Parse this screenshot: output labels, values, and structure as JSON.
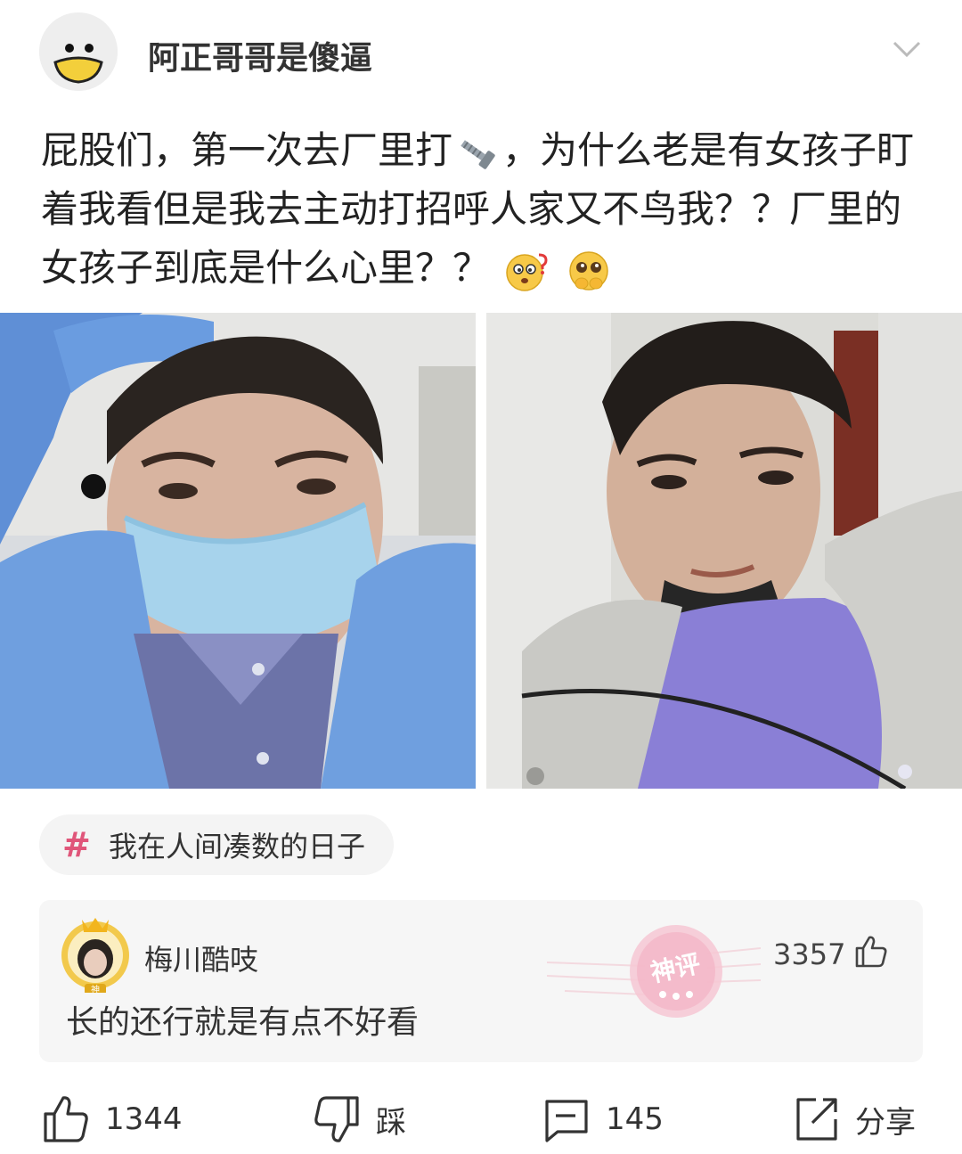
{
  "post": {
    "author": {
      "name": "阿正哥哥是傻逼",
      "avatar_icon": "smiling-face-avatar-icon"
    },
    "menu_icon": "chevron-down-icon",
    "text_part1": "屁股们，第一次去厂里打",
    "text_part2": "，为什么老是有女孩子盯着我看但是我去主动打招呼人家又不鸟我？？厂里的女孩子到底是什么心里？？",
    "inline_icons": [
      "screw-emoji",
      "confused-face-emoji",
      "pleading-face-emoji"
    ],
    "photos": [
      {
        "name": "selfie-cleanroom-suit"
      },
      {
        "name": "selfie-grey-jacket"
      }
    ],
    "topic": {
      "icon": "hash-icon",
      "label": "我在人间凑数的日子"
    }
  },
  "top_comment": {
    "author": "梅川酷吱",
    "badge": "神",
    "text": "长的还行就是有点不好看",
    "stamp_label": "神评",
    "likes": "3357"
  },
  "actions": {
    "like_count": "1344",
    "dislike_label": "踩",
    "comment_count": "145",
    "share_label": "分享"
  },
  "colors": {
    "accent": "#e0567a",
    "card_bg": "#f6f6f6",
    "text": "#222222"
  }
}
